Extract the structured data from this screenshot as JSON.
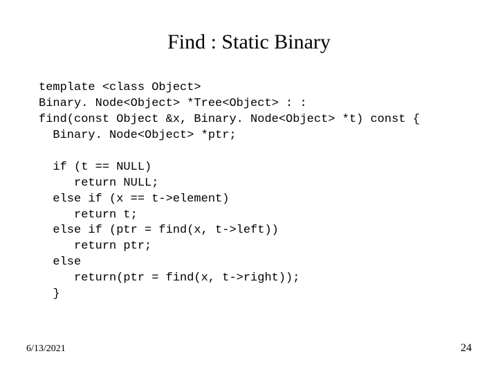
{
  "title": "Find : Static Binary",
  "code": "template <class Object>\nBinary. Node<Object> *Tree<Object> : :\nfind(const Object &x, Binary. Node<Object> *t) const {\n  Binary. Node<Object> *ptr;\n\n  if (t == NULL)\n     return NULL;\n  else if (x == t->element)\n     return t;\n  else if (ptr = find(x, t->left))\n     return ptr;\n  else\n     return(ptr = find(x, t->right));\n  }",
  "footer": {
    "date": "6/13/2021",
    "page": "24"
  }
}
